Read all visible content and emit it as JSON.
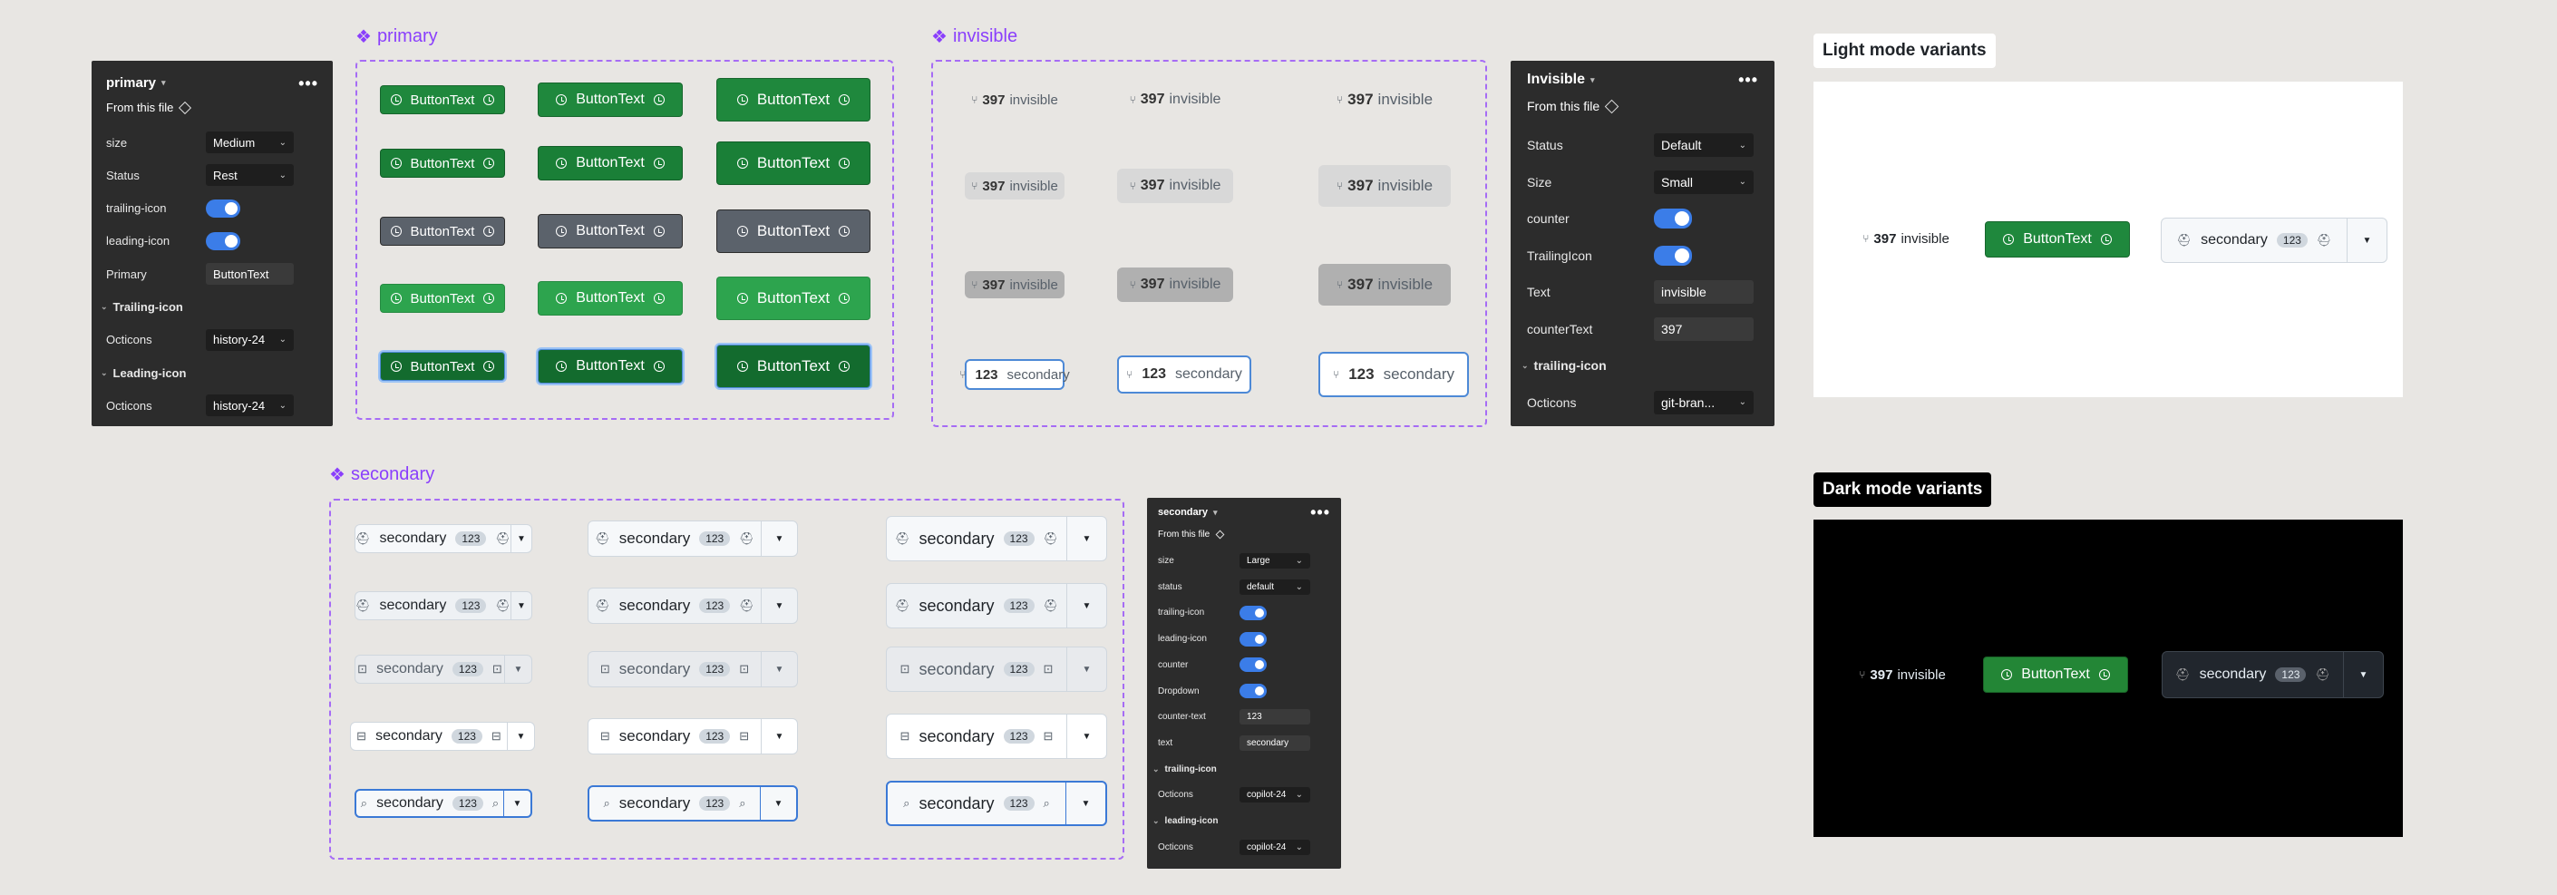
{
  "sections": {
    "primary": "primary",
    "invisible": "invisible",
    "secondary": "secondary",
    "diamond": "❖"
  },
  "primary_panel": {
    "title": "primary",
    "from": "From this file",
    "rows": [
      {
        "label": "size",
        "value": "Medium",
        "kind": "select"
      },
      {
        "label": "Status",
        "value": "Rest",
        "kind": "select"
      },
      {
        "label": "trailing-icon",
        "kind": "toggle"
      },
      {
        "label": "leading-icon",
        "kind": "toggle"
      },
      {
        "label": "Primary",
        "value": "ButtonText",
        "kind": "field"
      },
      {
        "label": "Trailing-icon",
        "kind": "section"
      },
      {
        "label": "Octicons",
        "value": "history-24",
        "kind": "select"
      },
      {
        "label": "Leading-icon",
        "kind": "section"
      },
      {
        "label": "Octicons",
        "value": "history-24",
        "kind": "select"
      }
    ]
  },
  "invisible_panel": {
    "title": "Invisible",
    "from": "From this file",
    "rows": [
      {
        "label": "Status",
        "value": "Default",
        "kind": "select"
      },
      {
        "label": "Size",
        "value": "Small",
        "kind": "select"
      },
      {
        "label": "counter",
        "kind": "toggle"
      },
      {
        "label": "TrailingIcon",
        "kind": "toggle"
      },
      {
        "label": "Text",
        "value": "invisible",
        "kind": "field"
      },
      {
        "label": "counterText",
        "value": "397",
        "kind": "field"
      },
      {
        "label": "trailing-icon",
        "kind": "section"
      },
      {
        "label": "Octicons",
        "value": "git-bran...",
        "kind": "select"
      }
    ]
  },
  "secondary_panel": {
    "title": "secondary",
    "from": "From this file",
    "rows": [
      {
        "label": "size",
        "value": "Large",
        "kind": "select"
      },
      {
        "label": "status",
        "value": "default",
        "kind": "select"
      },
      {
        "label": "trailing-icon",
        "kind": "toggle"
      },
      {
        "label": "leading-icon",
        "kind": "toggle"
      },
      {
        "label": "counter",
        "kind": "toggle"
      },
      {
        "label": "Dropdown",
        "kind": "toggle"
      },
      {
        "label": "counter-text",
        "value": "123",
        "kind": "field"
      },
      {
        "label": "text",
        "value": "secondary",
        "kind": "field"
      },
      {
        "label": "trailing-icon",
        "kind": "section"
      },
      {
        "label": "Octicons",
        "value": "copilot-24",
        "kind": "select"
      },
      {
        "label": "leading-icon",
        "kind": "section"
      },
      {
        "label": "Octicons",
        "value": "copilot-24",
        "kind": "select"
      }
    ]
  },
  "button_text": "ButtonText",
  "invisible_text": "invisible",
  "invisible_count": "397",
  "secondary_text": "secondary",
  "secondary_count": "123",
  "light": {
    "label": "Light mode variants",
    "invisible_count": "397",
    "invisible_text": "invisible",
    "primary_text": "ButtonText",
    "secondary_text": "secondary",
    "secondary_count": "123"
  },
  "dark": {
    "label": "Dark mode variants",
    "invisible_count": "397",
    "invisible_text": "invisible",
    "primary_text": "ButtonText",
    "secondary_text": "secondary",
    "secondary_count": "123"
  },
  "colors": {
    "primary": "#1f883d",
    "accent": "#8a3ffc",
    "panel": "#2c2c2c",
    "focus": "#0969da"
  }
}
